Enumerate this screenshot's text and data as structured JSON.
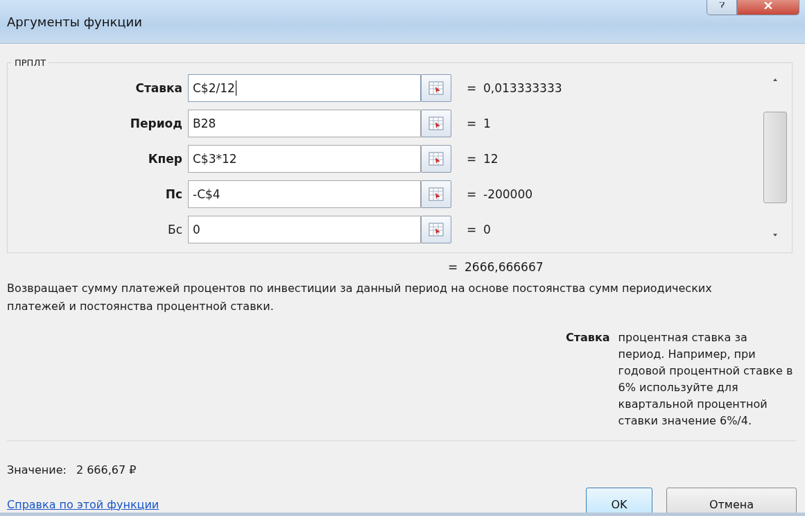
{
  "window": {
    "title": "Аргументы функции"
  },
  "function_group": {
    "name": "ПРПЛТ"
  },
  "arguments": [
    {
      "label": "Ставка",
      "required": true,
      "value": "C$2/12",
      "result": "0,013333333",
      "focused": true
    },
    {
      "label": "Период",
      "required": true,
      "value": "B28",
      "result": "1",
      "focused": false
    },
    {
      "label": "Кпер",
      "required": true,
      "value": "C$3*12",
      "result": "12",
      "focused": false
    },
    {
      "label": "Пс",
      "required": true,
      "value": "-C$4",
      "result": "-200000",
      "focused": false
    },
    {
      "label": "Бс",
      "required": false,
      "value": "0",
      "result": "0",
      "focused": false
    }
  ],
  "eq_sign": "=",
  "formula_result": "2666,666667",
  "description": "Возвращает сумму платежей процентов по инвестиции за данный период на основе постоянства сумм периодических платежей и постоянства процентной ставки.",
  "arg_help": {
    "label": "Ставка",
    "text": "процентная ставка за период. Например, при годовой процентной ставке в 6% используйте для квартальной процентной ставки значение 6%/4."
  },
  "value_label": "Значение:",
  "value": "2 666,67 ₽",
  "help_link": "Справка по этой функции",
  "buttons": [
    {
      "label": "OK",
      "kind": "default"
    },
    {
      "label": "Отмена",
      "kind": "normal"
    }
  ]
}
